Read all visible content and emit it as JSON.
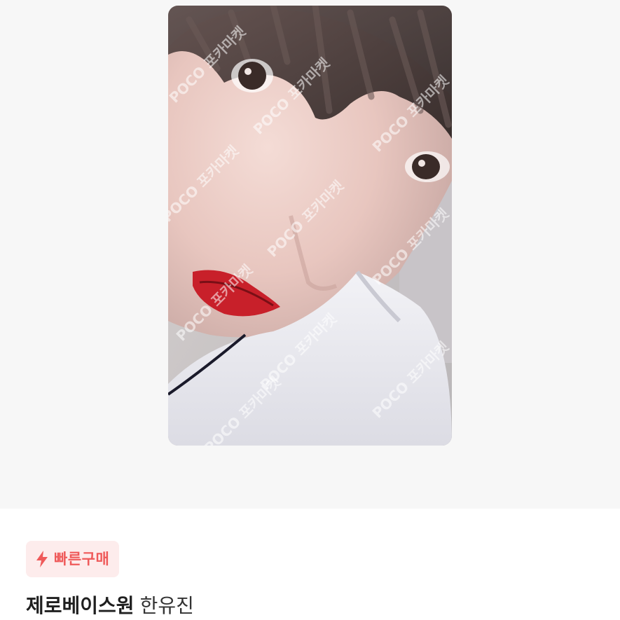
{
  "product_image": {
    "watermark": "POCO 포카마켓"
  },
  "badge": {
    "icon": "lightning-icon",
    "label": "빠른구매",
    "color": "#ef5a5a",
    "background": "#fdecec"
  },
  "product": {
    "group": "제로베이스원",
    "member": "한유진"
  }
}
